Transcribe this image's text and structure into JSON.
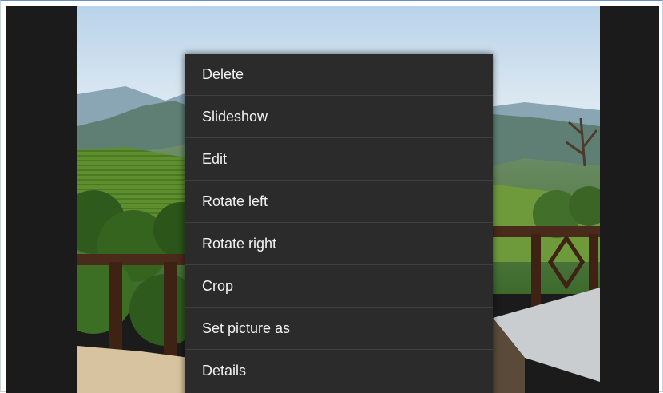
{
  "context_menu": {
    "items": [
      {
        "label": "Delete"
      },
      {
        "label": "Slideshow"
      },
      {
        "label": "Edit"
      },
      {
        "label": "Rotate left"
      },
      {
        "label": "Rotate right"
      },
      {
        "label": "Crop"
      },
      {
        "label": "Set picture as"
      },
      {
        "label": "Details"
      }
    ]
  },
  "colors": {
    "menu_background": "#2b2b2b",
    "menu_divider": "#404040",
    "menu_text": "#f2f2f2",
    "letterbox": "#1b1b1b"
  }
}
